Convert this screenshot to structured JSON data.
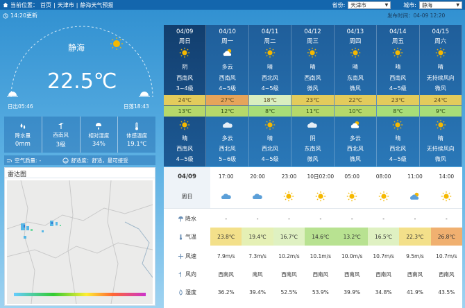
{
  "breadcrumb": {
    "label": "当前位置：",
    "home": "首页",
    "sep1": "|",
    "city": "天津市",
    "sep2": "|",
    "page": "静海天气预报"
  },
  "selects": {
    "province_label": "省份:",
    "province_value": "天津市",
    "city_label": "城市:",
    "city_value": "静海"
  },
  "update_time": "14:20更新",
  "publish_time": "发布时间：04-09 12:20",
  "current": {
    "city": "静海",
    "temperature": "22.5℃",
    "sunrise": "日出05:46",
    "sunset": "日落18:43"
  },
  "stats": [
    {
      "icon": "rain-drop-icon",
      "label": "降水量",
      "value": "0mm"
    },
    {
      "icon": "wind-icon",
      "label": "西南风",
      "value": "3级"
    },
    {
      "icon": "humidity-icon",
      "label": "相对湿度",
      "value": "34%"
    },
    {
      "icon": "thermometer-icon",
      "label": "体感温度",
      "value": "19.1℃"
    }
  ],
  "air_quality": {
    "label": "空气质量:",
    "value": "-",
    "comfort": "舒适度：舒适，最可接受"
  },
  "radar": {
    "title": "雷达图"
  },
  "days": [
    {
      "date": "04/09",
      "weekday": "周日",
      "icon1": "sun-icon",
      "weather1": "阴",
      "wind_dir1": "西南风",
      "wind_lvl1": "3~4级",
      "high": "24℃",
      "hi_color": "#e3cb5b",
      "low": "13℃",
      "lo_color": "#b6d86a",
      "icon2": "sun-icon",
      "weather2": "晴",
      "wind_dir2": "西南风",
      "wind_lvl2": "4~5级"
    },
    {
      "date": "04/10",
      "weekday": "周一",
      "icon1": "cloud-sun-icon",
      "weather1": "多云",
      "wind_dir1": "西南风",
      "wind_lvl1": "4~5级",
      "high": "27℃",
      "hi_color": "#e6a45a",
      "low": "12℃",
      "lo_color": "#b6d86a",
      "icon2": "cloud-icon",
      "weather2": "多云",
      "wind_dir2": "西北风",
      "wind_lvl2": "5~6级"
    },
    {
      "date": "04/11",
      "weekday": "周二",
      "icon1": "sun-icon",
      "weather1": "晴",
      "wind_dir1": "西北风",
      "wind_lvl1": "4~5级",
      "high": "18℃",
      "hi_color": "#d9eebf",
      "low": "8℃",
      "lo_color": "#a8dd78",
      "icon2": "sun-icon",
      "weather2": "晴",
      "wind_dir2": "西北风",
      "wind_lvl2": "4~5级"
    },
    {
      "date": "04/12",
      "weekday": "周三",
      "icon1": "sun-icon",
      "weather1": "晴",
      "wind_dir1": "西南风",
      "wind_lvl1": "微风",
      "high": "23℃",
      "hi_color": "#e3cb5b",
      "low": "11℃",
      "lo_color": "#b6d86a",
      "icon2": "cloud-icon",
      "weather2": "阴",
      "wind_dir2": "东南风",
      "wind_lvl2": "微风"
    },
    {
      "date": "04/13",
      "weekday": "周四",
      "icon1": "sun-icon",
      "weather1": "晴",
      "wind_dir1": "东南风",
      "wind_lvl1": "微风",
      "high": "22℃",
      "hi_color": "#e3cb5b",
      "low": "10℃",
      "lo_color": "#b6d86a",
      "icon2": "cloud-sun-icon",
      "weather2": "多云",
      "wind_dir2": "西北风",
      "wind_lvl2": "微风"
    },
    {
      "date": "04/14",
      "weekday": "周五",
      "icon1": "sun-icon",
      "weather1": "晴",
      "wind_dir1": "西南风",
      "wind_lvl1": "4~5级",
      "high": "23℃",
      "hi_color": "#e3cb5b",
      "low": "8℃",
      "lo_color": "#a8dd78",
      "icon2": "sun-icon",
      "weather2": "晴",
      "wind_dir2": "西北风",
      "wind_lvl2": "4~5级"
    },
    {
      "date": "04/15",
      "weekday": "周六",
      "icon1": "sun-icon",
      "weather1": "晴",
      "wind_dir1": "无持续风向",
      "wind_lvl1": "微风",
      "high": "24℃",
      "hi_color": "#e3cb5b",
      "low": "9℃",
      "lo_color": "#a8dd78",
      "icon2": "sun-icon",
      "weather2": "晴",
      "wind_dir2": "无持续风向",
      "wind_lvl2": "微风"
    }
  ],
  "hourly": {
    "today": "04/09",
    "weekday": "周日",
    "row_labels": {
      "rain": "降水",
      "temp": "气温",
      "wind_speed": "风速",
      "wind_dir": "风向",
      "humidity": "湿度"
    },
    "times": [
      "17:00",
      "20:00",
      "23:00",
      "10日02:00",
      "05:00",
      "08:00",
      "11:00",
      "14:00"
    ],
    "icons": [
      "cloud-icon",
      "cloud-icon",
      "sun-icon",
      "sun-icon",
      "sun-icon",
      "sun-icon",
      "cloud-sun-icon",
      "sun-icon"
    ],
    "rain": [
      "-",
      "-",
      "-",
      "-",
      "-",
      "-",
      "-",
      "-"
    ],
    "temps": [
      "23.8℃",
      "19.4℃",
      "16.7℃",
      "14.6℃",
      "13.2℃",
      "16.5℃",
      "22.3℃",
      "26.8℃"
    ],
    "temp_colors": [
      "#f3e08a",
      "#e5f0b5",
      "#dff1c2",
      "#b8e291",
      "#b8e291",
      "#dff1c2",
      "#f3e08a",
      "#f0b070"
    ],
    "wind_speeds": [
      "7.9m/s",
      "7.3m/s",
      "10.2m/s",
      "10.1m/s",
      "10.0m/s",
      "10.7m/s",
      "9.5m/s",
      "10.7m/s"
    ],
    "wind_dirs": [
      "西南风",
      "南风",
      "西南风",
      "西南风",
      "西南风",
      "西南风",
      "西南风",
      "西南风"
    ],
    "humidity": [
      "36.2%",
      "39.4%",
      "52.5%",
      "53.9%",
      "39.9%",
      "34.8%",
      "41.9%",
      "43.5%"
    ]
  },
  "colors": {
    "topbar": "#1366ad",
    "today_column": "#123e6e",
    "sun": "#f5b800"
  }
}
